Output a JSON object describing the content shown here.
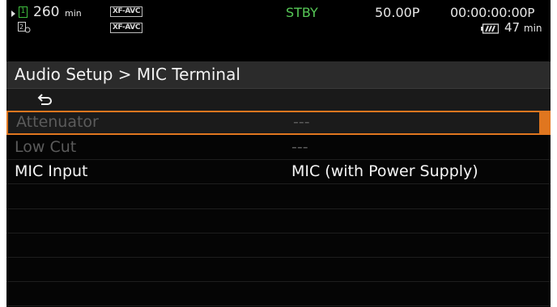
{
  "status": {
    "card_slot": "1",
    "record_time": "260",
    "record_time_unit": "min",
    "format_badge_1": "XF-AVC",
    "format_badge_2": "XF-AVC",
    "mode": "STBY",
    "frame_rate": "50.00P",
    "timecode": "00:00:00:00",
    "timecode_suffix": "P",
    "battery_remaining": "47",
    "battery_unit": "min"
  },
  "menu": {
    "breadcrumb": "Audio Setup > MIC Terminal",
    "items": [
      {
        "label": "Attenuator",
        "value": "---",
        "enabled": false,
        "selected": true
      },
      {
        "label": "Low Cut",
        "value": "---",
        "enabled": false,
        "selected": false
      },
      {
        "label": "MIC Input",
        "value": "MIC (with Power Supply)",
        "enabled": true,
        "selected": false
      }
    ]
  },
  "colors": {
    "selection": "#e0761f",
    "standby": "#57c957",
    "card_icon": "#3fbf3f"
  },
  "icons": [
    "play-icon",
    "card-slot-icon",
    "slot-relay-icon",
    "back-icon",
    "battery-icon"
  ]
}
